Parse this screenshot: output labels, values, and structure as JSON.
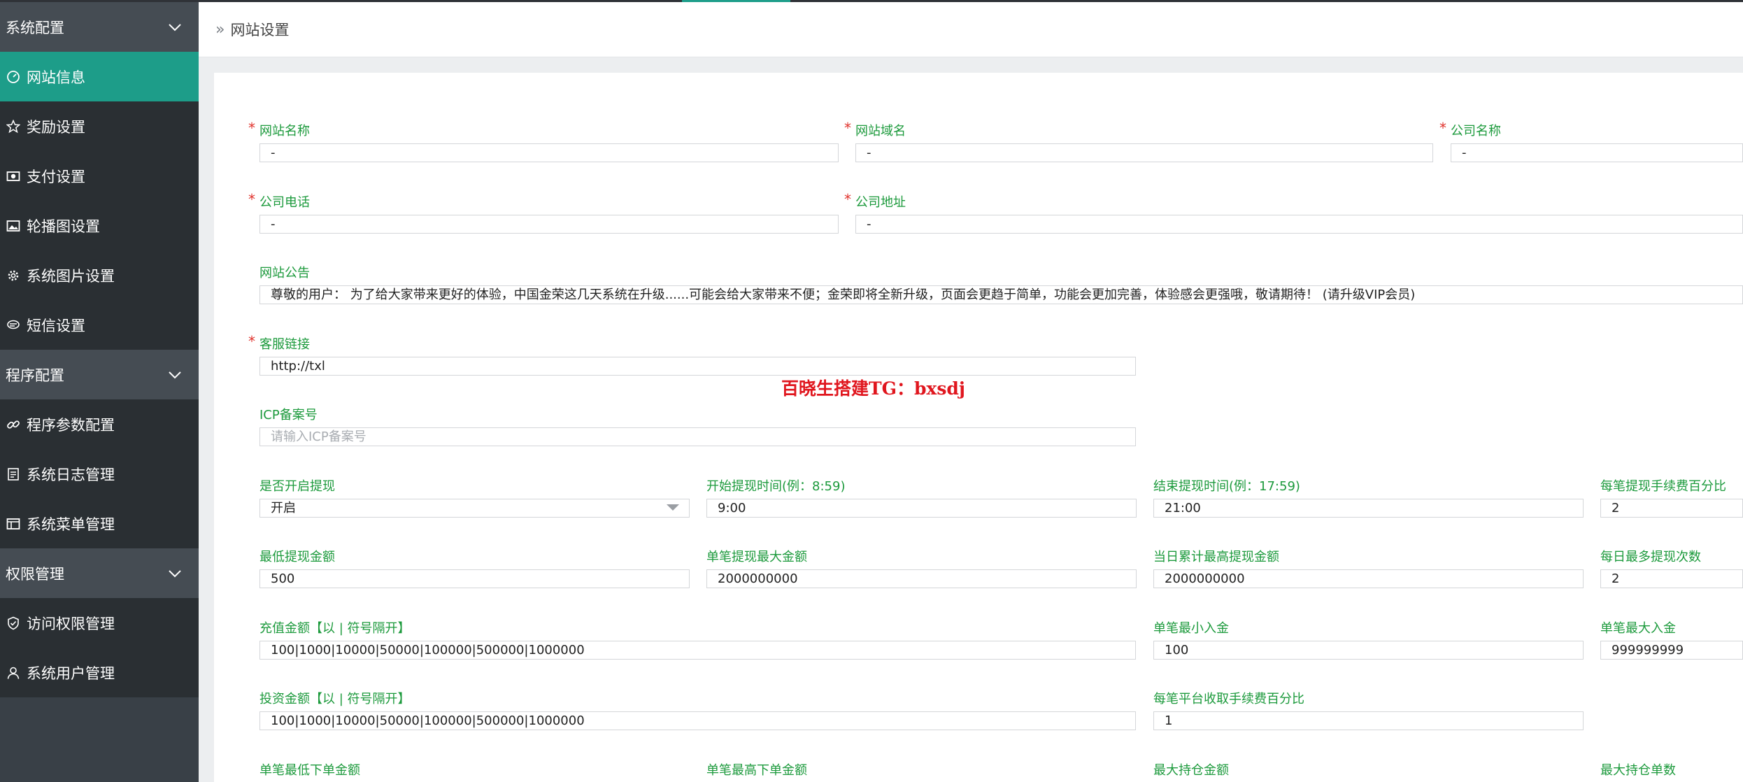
{
  "sidebar": {
    "groups": [
      {
        "label": "系统配置",
        "items": [
          {
            "label": "网站信息",
            "icon": "dashboard-icon",
            "active": true
          },
          {
            "label": "奖励设置",
            "icon": "star-icon"
          },
          {
            "label": "支付设置",
            "icon": "money-icon"
          },
          {
            "label": "轮播图设置",
            "icon": "image-icon"
          },
          {
            "label": "系统图片设置",
            "icon": "gear-icon"
          },
          {
            "label": "短信设置",
            "icon": "message-icon"
          }
        ]
      },
      {
        "label": "程序配置",
        "items": [
          {
            "label": "程序参数配置",
            "icon": "link-icon"
          },
          {
            "label": "系统日志管理",
            "icon": "log-icon"
          },
          {
            "label": "系统菜单管理",
            "icon": "window-icon"
          }
        ]
      },
      {
        "label": "权限管理",
        "items": [
          {
            "label": "访问权限管理",
            "icon": "shield-icon"
          },
          {
            "label": "系统用户管理",
            "icon": "user-icon"
          }
        ]
      }
    ]
  },
  "header": {
    "breadcrumb": "网站设置"
  },
  "watermark": "百晓生搭建TG：bxsdj",
  "form": {
    "site_name": {
      "label": "网站名称",
      "value": "-"
    },
    "site_domain": {
      "label": "网站域名",
      "value": "-"
    },
    "company_name": {
      "label": "公司名称",
      "value": "-"
    },
    "company_phone": {
      "label": "公司电话",
      "value": "-"
    },
    "company_address": {
      "label": "公司地址",
      "value": "-"
    },
    "notice": {
      "label": "网站公告",
      "value": "尊敬的用户：  为了给大家带来更好的体验，中国金荣这几天系统在升级......可能会给大家带来不便；金荣即将全新升级，页面会更趋于简单，功能会更加完善，体验感会更强哦，敬请期待！  (请升级VIP会员)"
    },
    "service_link": {
      "label": "客服链接",
      "value": "http://txl"
    },
    "icp": {
      "label": "ICP备案号",
      "placeholder": "请输入ICP备案号"
    },
    "withdraw_enabled": {
      "label": "是否开启提现",
      "value": "开启"
    },
    "withdraw_start": {
      "label": "开始提现时间(例：8:59)",
      "value": "9:00"
    },
    "withdraw_end": {
      "label": "结束提现时间(例：17:59)",
      "value": "21:00"
    },
    "withdraw_fee": {
      "label": "每笔提现手续费百分比",
      "value": "2"
    },
    "min_withdraw": {
      "label": "最低提现金额",
      "value": "500"
    },
    "max_withdraw": {
      "label": "单笔提现最大金额",
      "value": "2000000000"
    },
    "daily_withdraw": {
      "label": "当日累计最高提现金额",
      "value": "2000000000"
    },
    "daily_withdraw_times": {
      "label": "每日最多提现次数",
      "value": "2"
    },
    "recharge_amounts": {
      "label": "充值金额【以 | 符号隔开】",
      "value": "100|1000|10000|50000|100000|500000|1000000"
    },
    "min_deposit": {
      "label": "单笔最小入金",
      "value": "100"
    },
    "max_deposit": {
      "label": "单笔最大入金",
      "value": "999999999"
    },
    "invest_amounts": {
      "label": "投资金额【以 | 符号隔开】",
      "value": "100|1000|10000|50000|100000|500000|1000000"
    },
    "platform_fee": {
      "label": "每笔平台收取手续费百分比",
      "value": "1"
    },
    "min_order": {
      "label": "单笔最低下单金额"
    },
    "max_order": {
      "label": "单笔最高下单金额"
    },
    "max_position": {
      "label": "最大持仓金额"
    },
    "max_position_count": {
      "label": "最大持仓单数"
    }
  }
}
